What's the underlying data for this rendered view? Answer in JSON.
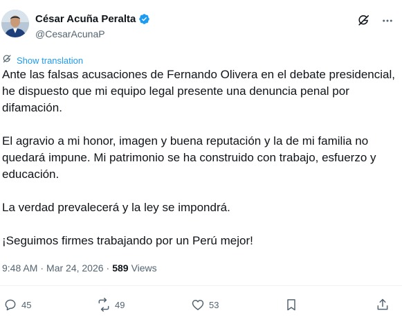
{
  "author": {
    "display_name": "César Acuña Peralta",
    "handle": "@CesarAcunaP",
    "verified_icon": "verified-badge-icon",
    "verified_color": "#1d9bf0"
  },
  "top_actions": {
    "grok_icon": "grok-icon",
    "more_icon": "more-icon"
  },
  "translation": {
    "label": "Show translation",
    "icon": "translate-icon"
  },
  "post": {
    "paragraphs": [
      "Ante las falsas acusaciones de Fernando Olivera en el debate presidencial, he dispuesto que mi equipo legal presente una denuncia penal por difamación.",
      "El agravio a mi honor, imagen y buena reputación y la de mi familia no quedará impune. Mi patrimonio se ha construido con trabajo, esfuerzo y educación.",
      "La verdad prevalecerá y la ley se impondrá.",
      "¡Seguimos firmes trabajando por un Perú mejor!"
    ]
  },
  "meta": {
    "time": "9:48 AM",
    "separator": "·",
    "date": "Mar 24, 2026",
    "separator2": "·",
    "views_count": "589",
    "views_label": "Views"
  },
  "actions": {
    "replies": "45",
    "reposts": "49",
    "likes": "53"
  },
  "colors": {
    "text": "#0f1419",
    "secondary": "#536471",
    "link": "#1d9bf0"
  }
}
